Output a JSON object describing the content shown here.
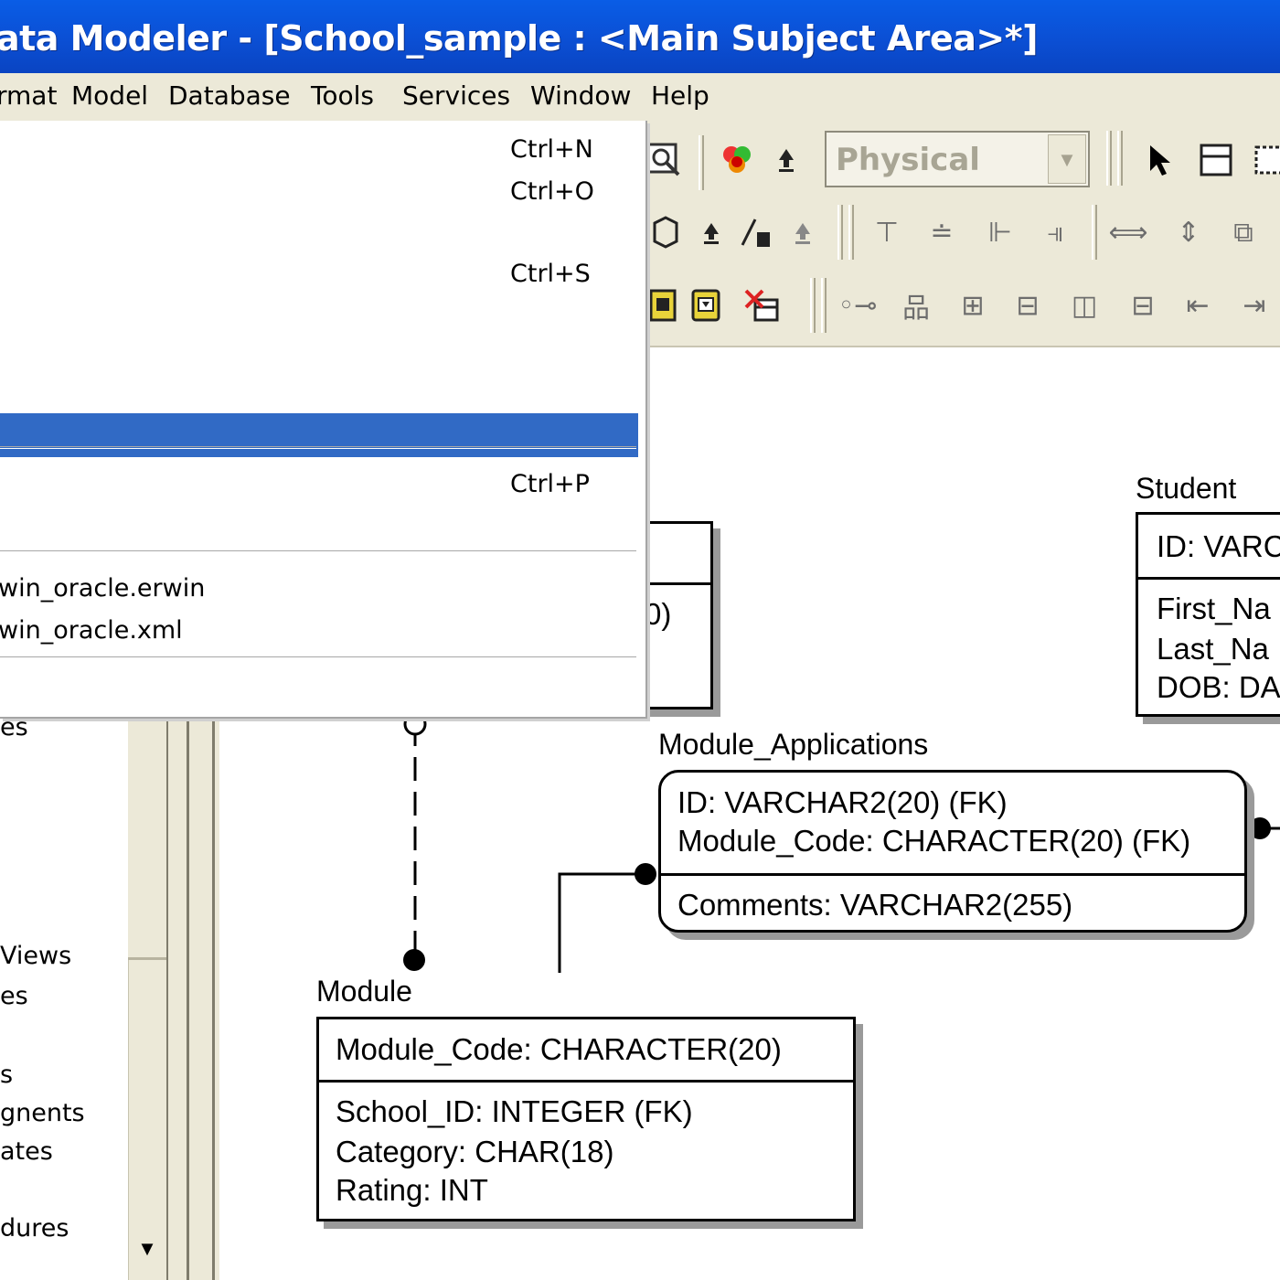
{
  "window": {
    "title": "ata Modeler - [School_sample : <Main Subject Area>*]"
  },
  "menubar": {
    "items": [
      "rmat",
      "Model",
      "Database",
      "Tools",
      "Services",
      "Window",
      "Help"
    ]
  },
  "toolbar": {
    "view_combo_value": "Physical",
    "icons": [
      "zoom-icon",
      "color-icon",
      "pointer-icon",
      "entity-icon",
      "subtype-icon"
    ]
  },
  "file_menu": {
    "shortcuts": {
      "new": "Ctrl+N",
      "open": "Ctrl+O",
      "save": "Ctrl+S",
      "print": "Ctrl+P"
    },
    "recent_files": [
      "win_oracle.erwin",
      "win_oracle.xml"
    ]
  },
  "left_panel": {
    "items": [
      "es",
      "Views",
      "es",
      "s",
      "gnents",
      "ates",
      "dures"
    ]
  },
  "diagram": {
    "partial_entity_fragment": "0)",
    "entities": {
      "student": {
        "name": "Student",
        "keys": [
          "ID: VARC"
        ],
        "attributes": [
          "First_Na",
          "Last_Na",
          "DOB: DA"
        ]
      },
      "module_applications": {
        "name": "Module_Applications",
        "keys": [
          "ID: VARCHAR2(20) (FK)",
          "Module_Code: CHARACTER(20) (FK)"
        ],
        "attributes": [
          "Comments: VARCHAR2(255)"
        ]
      },
      "module": {
        "name": "Module",
        "keys": [
          "Module_Code: CHARACTER(20)"
        ],
        "attributes": [
          "School_ID: INTEGER (FK)",
          "Category: CHAR(18)",
          "Rating: INT"
        ]
      }
    }
  }
}
